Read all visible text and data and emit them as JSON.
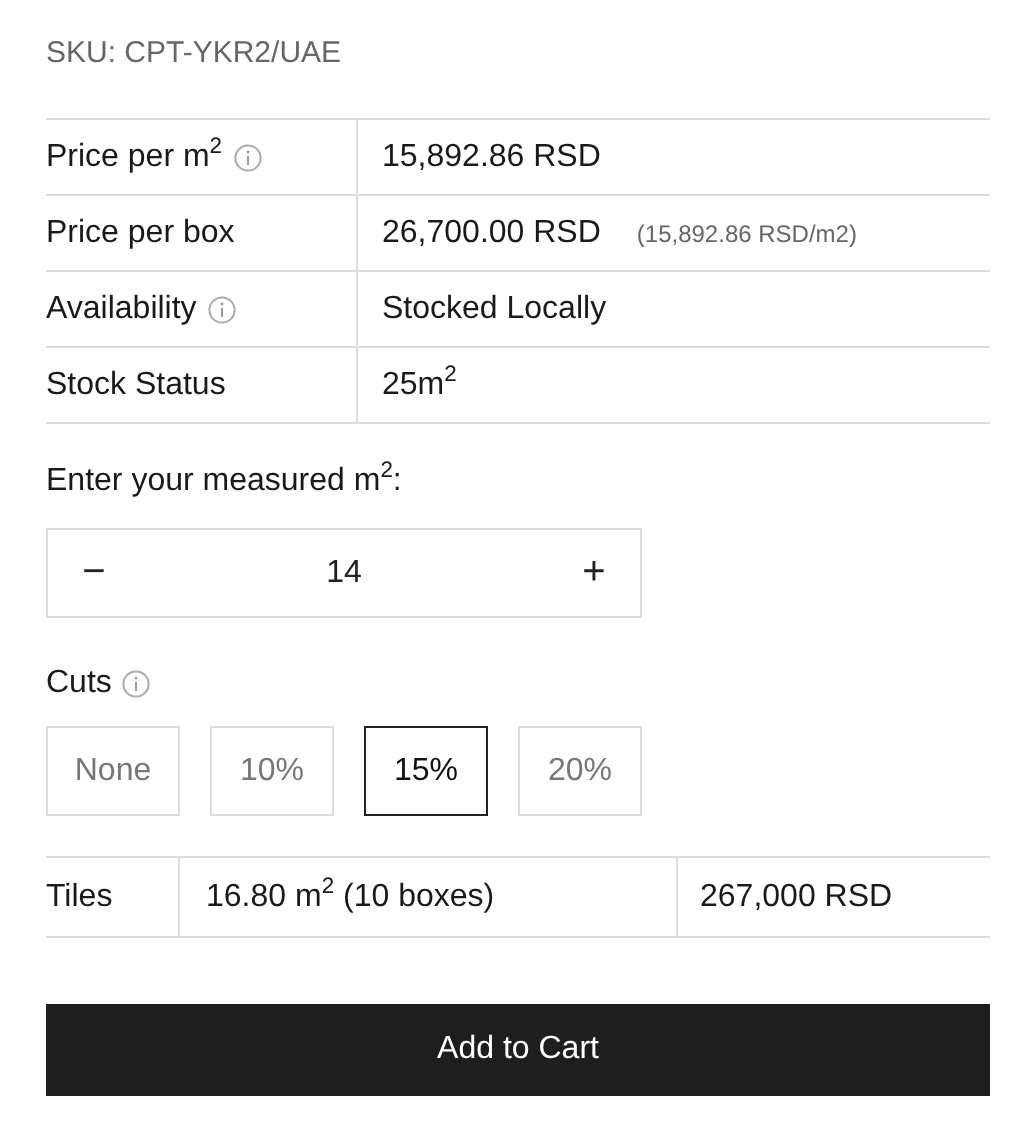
{
  "sku": "SKU: CPT-YKR2/UAE",
  "specs": [
    {
      "label": "Price per m$^{2}$",
      "info": true,
      "value": "15,892.86 RSD"
    },
    {
      "label": "Price per box",
      "info": false,
      "value": "26,700.00 RSD",
      "note": "(15,892.86 RSD/m2)"
    },
    {
      "label": "Availability",
      "info": true,
      "value": "Stocked Locally"
    },
    {
      "label": "Stock Status",
      "info": false,
      "value": "25m$^{2}$"
    }
  ],
  "measure": {
    "label": "Enter your measured m$^{2}$:",
    "decrement": "−",
    "value": "14",
    "increment": "+"
  },
  "cuts": {
    "label": "Cuts",
    "info": true,
    "options": [
      {
        "label": "None",
        "selected": false
      },
      {
        "label": "10%",
        "selected": false
      },
      {
        "label": "15%",
        "selected": true
      },
      {
        "label": "20%",
        "selected": false
      }
    ]
  },
  "summary": {
    "product": "Tiles",
    "quantity": "16.80 m$^{2}$ (10 boxes)",
    "total": "267,000 RSD"
  },
  "add_to_cart": "Add to Cart"
}
